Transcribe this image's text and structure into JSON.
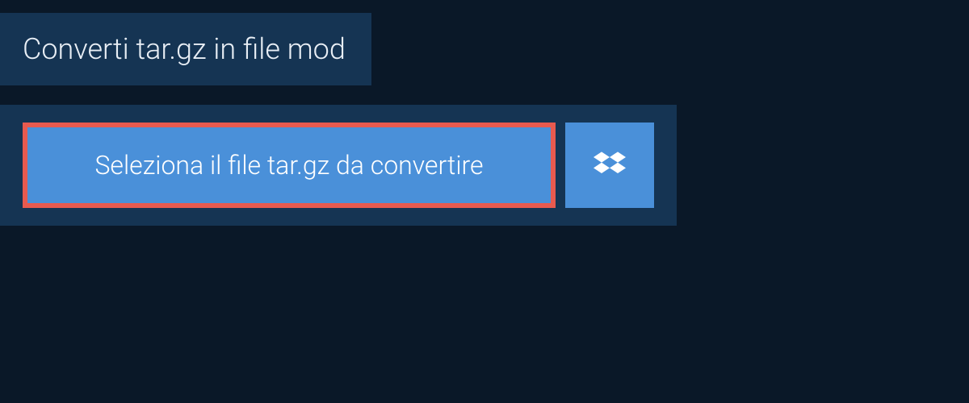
{
  "header": {
    "title": "Converti tar.gz in file mod"
  },
  "upload": {
    "select_file_label": "Seleziona il file tar.gz da convertire",
    "dropbox_icon": "dropbox"
  }
}
